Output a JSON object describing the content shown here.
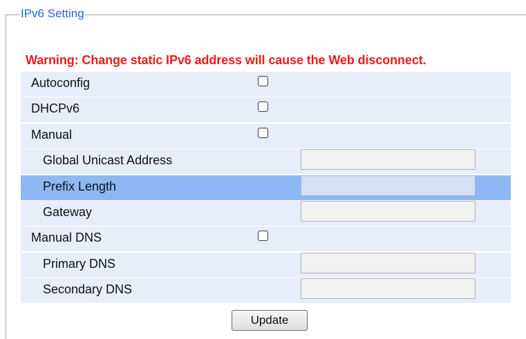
{
  "fieldset": {
    "legend": "IPv6 Setting"
  },
  "warning": "Warning: Change static IPv6 address will cause the Web disconnect.",
  "rows": [
    {
      "label": "Autoconfig",
      "control": "checkbox",
      "checked": false
    },
    {
      "label": "DHCPv6",
      "control": "checkbox",
      "checked": false
    },
    {
      "label": "Manual",
      "control": "checkbox",
      "checked": false
    },
    {
      "label": "Global Unicast Address",
      "control": "text",
      "value": ""
    },
    {
      "label": "Prefix Length",
      "control": "text",
      "value": "",
      "selected": true
    },
    {
      "label": "Gateway",
      "control": "text",
      "value": ""
    },
    {
      "label": "Manual DNS",
      "control": "checkbox",
      "checked": false
    },
    {
      "label": "Primary DNS",
      "control": "text",
      "value": ""
    },
    {
      "label": "Secondary DNS",
      "control": "text",
      "value": ""
    }
  ],
  "buttons": {
    "update": "Update"
  },
  "colors": {
    "legend": "#2a66c7",
    "warning": "#ea1c1c",
    "row_background": "#e7edf9",
    "row_selected": "#8db8f4"
  }
}
